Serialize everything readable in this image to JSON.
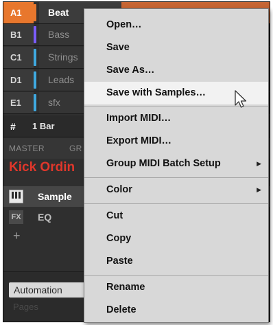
{
  "groups": [
    {
      "id": "A1",
      "name": "Beat",
      "color": "#e8772d",
      "selected": true
    },
    {
      "id": "B1",
      "name": "Bass",
      "color": "#7b5cff",
      "selected": false
    },
    {
      "id": "C1",
      "name": "Strings",
      "color": "#3fa9e0",
      "selected": false
    },
    {
      "id": "D1",
      "name": "Leads",
      "color": "#3fa9e0",
      "selected": false
    },
    {
      "id": "E1",
      "name": "sfx",
      "color": "#3fa9e0",
      "selected": false
    }
  ],
  "pattern": {
    "hash_label": "#",
    "length": "1 Bar"
  },
  "tabs": {
    "master": "MASTER",
    "group": "GR"
  },
  "sound_name": "Kick Ordin",
  "slots": {
    "sampler": "Sample",
    "fx": "EQ",
    "fx_icon": "FX",
    "add": "+"
  },
  "lower": {
    "automation": "Automation",
    "pages": "Pages"
  },
  "context_menu": {
    "items": [
      {
        "label": "Open…",
        "hover": false
      },
      {
        "label": "Save",
        "hover": false
      },
      {
        "label": "Save As…",
        "hover": false
      },
      {
        "label": "Save with Samples…",
        "hover": true
      },
      {
        "label": "Import MIDI…",
        "hover": false
      },
      {
        "label": "Export MIDI…",
        "hover": false
      },
      {
        "label": "Group MIDI Batch Setup",
        "hover": false,
        "submenu": true
      },
      {
        "label": "Color",
        "hover": false,
        "submenu": true
      },
      {
        "label": "Cut",
        "hover": false
      },
      {
        "label": "Copy",
        "hover": false
      },
      {
        "label": "Paste",
        "hover": false
      },
      {
        "label": "Rename",
        "hover": false
      },
      {
        "label": "Delete",
        "hover": false
      }
    ],
    "submenu_icon": "triangle-right-icon"
  },
  "colors": {
    "accent_orange": "#e8772d",
    "sound_name_red": "#e0372b",
    "menu_bg": "#d8d8d8",
    "menu_hover": "#f2f2f2"
  },
  "cursor_icon": "mouse-pointer-icon"
}
